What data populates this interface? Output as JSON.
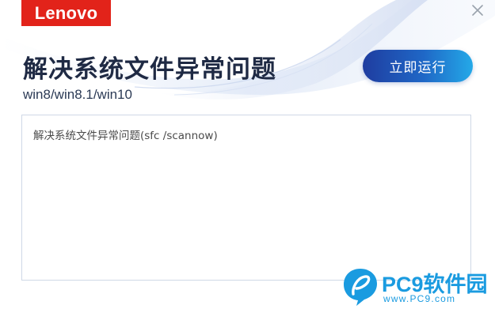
{
  "brand": {
    "logo_text": "Lenovo",
    "logo_color": "#e2231a"
  },
  "header": {
    "title": "解决系统文件异常问题",
    "subtitle": "win8/win8.1/win10"
  },
  "actions": {
    "run_label": "立即运行"
  },
  "output": {
    "log_text": "解决系统文件异常问题(sfc /scannow)"
  },
  "watermark": {
    "brand": "PC9软件园",
    "url": "www.PC9.com"
  },
  "icons": {
    "close": "close-icon",
    "watermark": "pc9-logo-icon"
  },
  "colors": {
    "accent_start": "#1f3da0",
    "accent_end": "#24a9e8",
    "title": "#1f2a44",
    "watermark": "#1a9be0"
  }
}
